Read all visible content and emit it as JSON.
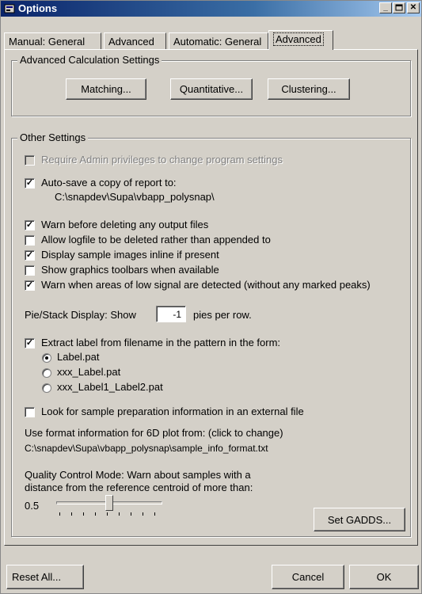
{
  "window": {
    "title": "Options"
  },
  "tabs": [
    {
      "label": "Manual: General"
    },
    {
      "label": "Advanced"
    },
    {
      "label": "Automatic: General"
    },
    {
      "label": "Advanced",
      "active": true
    }
  ],
  "advanced_calc": {
    "title": "Advanced Calculation Settings",
    "buttons": [
      "Matching...",
      "Quantitative...",
      "Clustering..."
    ]
  },
  "other": {
    "title": "Other Settings",
    "require_admin": {
      "label": "Require Admin privileges to change program settings",
      "checked": false,
      "disabled": true
    },
    "autosave": {
      "label": "Auto-save a copy of report to:",
      "checked": true,
      "path": "C:\\snapdev\\Supa\\vbapp_polysnap\\"
    },
    "options": [
      {
        "label": "Warn before deleting any output files",
        "checked": true
      },
      {
        "label": "Allow logfile to be deleted rather than appended to",
        "checked": false
      },
      {
        "label": "Display sample images inline if present",
        "checked": true
      },
      {
        "label": "Show graphics toolbars when available",
        "checked": false
      },
      {
        "label": "Warn when areas of low signal are detected (without any marked peaks)",
        "checked": true
      }
    ],
    "pie": {
      "prefix": "Pie/Stack Display:  Show",
      "value": "-1",
      "suffix": "pies per row."
    },
    "extract": {
      "label": "Extract label from filename in the pattern in the form:",
      "checked": true,
      "patterns": [
        {
          "label": "Label.pat",
          "selected": true
        },
        {
          "label": "xxx_Label.pat",
          "selected": false
        },
        {
          "label": "xxx_Label1_Label2.pat",
          "selected": false
        }
      ]
    },
    "lookfor": {
      "label": "Look for sample preparation information in an external file",
      "checked": false
    },
    "format_info": {
      "label": "Use format information for 6D plot from: (click to change)",
      "path": "C:\\snapdev\\Supa\\vbapp_polysnap\\sample_info_format.txt"
    },
    "quality": {
      "line1": "Quality Control Mode: Warn about samples with a",
      "line2": "distance from the reference centroid of more than:",
      "value": "0.5",
      "slider_fraction": 0.5,
      "button": "Set GADDS..."
    }
  },
  "footer": {
    "reset": "Reset All...",
    "cancel": "Cancel",
    "ok": "OK"
  }
}
